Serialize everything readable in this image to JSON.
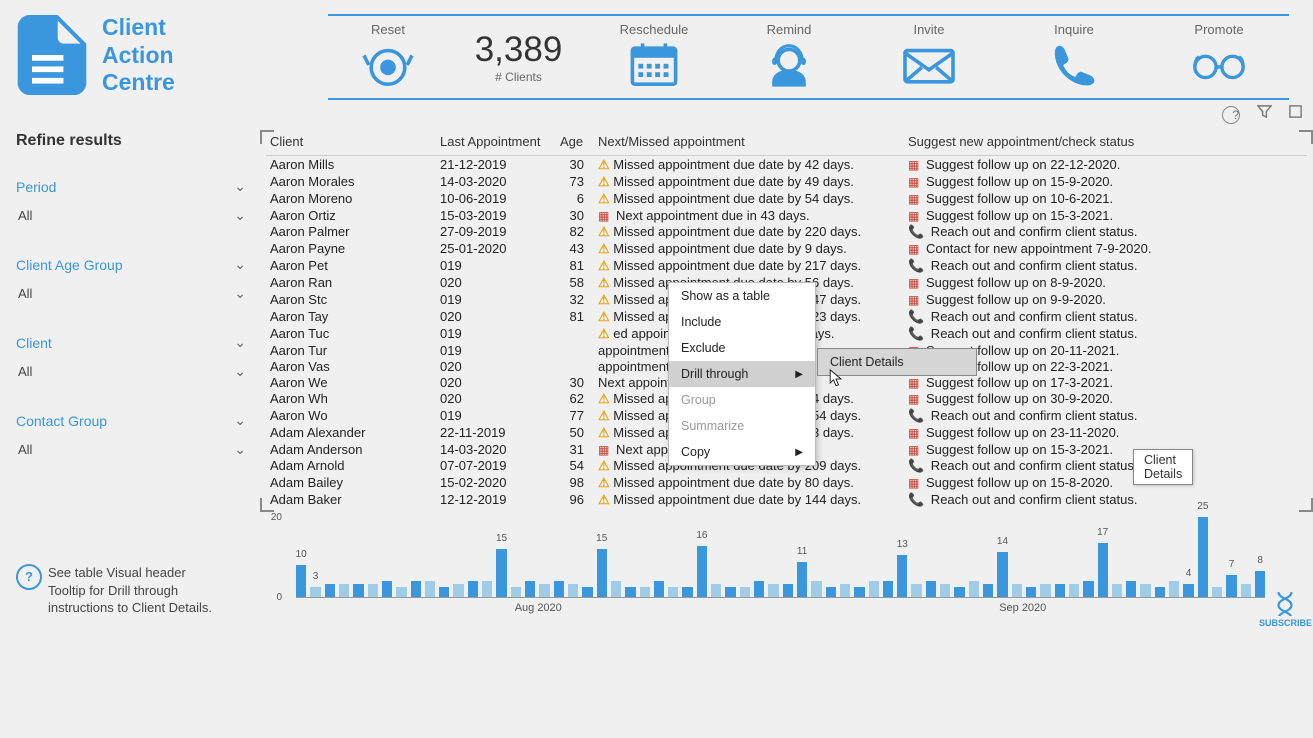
{
  "app": {
    "title_line1": "Client",
    "title_line2": "Action",
    "title_line3": "Centre"
  },
  "cards": {
    "reset": "Reset",
    "clients_value": "3,389",
    "clients_label": "# Clients",
    "reschedule": "Reschedule",
    "remind": "Remind",
    "invite": "Invite",
    "inquire": "Inquire",
    "promote": "Promote"
  },
  "filters": {
    "header": "Refine results",
    "period": {
      "label": "Period",
      "value": "All"
    },
    "age_group": {
      "label": "Client Age Group",
      "value": "All"
    },
    "client": {
      "label": "Client",
      "value": "All"
    },
    "contact_group": {
      "label": "Contact Group",
      "value": "All"
    }
  },
  "tip": "See table Visual header Tooltip for Drill through instructions to Client Details.",
  "table": {
    "headers": {
      "client": "Client",
      "last": "Last Appointment",
      "age": "Age",
      "next": "Next/Missed appointment",
      "suggest": "Suggest new appointment/check status"
    },
    "rows": [
      {
        "client": "Aaron Mills",
        "last": "21-12-2019",
        "age": "30",
        "next_icon": "warn",
        "next": "Missed appointment due date by 42 days.",
        "sugg_icon": "cal",
        "sugg": "Suggest follow up on 22-12-2020."
      },
      {
        "client": "Aaron Morales",
        "last": "14-03-2020",
        "age": "73",
        "next_icon": "warn",
        "next": "Missed appointment due date by 49 days.",
        "sugg_icon": "cal",
        "sugg": "Suggest follow up on 15-9-2020."
      },
      {
        "client": "Aaron Moreno",
        "last": "10-06-2019",
        "age": "6",
        "next_icon": "warn",
        "next": "Missed appointment due date by 54 days.",
        "sugg_icon": "cal",
        "sugg": "Suggest follow up on 10-6-2021."
      },
      {
        "client": "Aaron Ortiz",
        "last": "15-03-2019",
        "age": "30",
        "next_icon": "cal",
        "next": "Next appointment due in 43 days.",
        "sugg_icon": "cal",
        "sugg": "Suggest follow up on 15-3-2021."
      },
      {
        "client": "Aaron Palmer",
        "last": "27-09-2019",
        "age": "82",
        "next_icon": "warn",
        "next": "Missed appointment due date by 220 days.",
        "sugg_icon": "phone",
        "sugg": "Reach out and confirm client status."
      },
      {
        "client": "Aaron Payne",
        "last": "25-01-2020",
        "age": "43",
        "next_icon": "warn",
        "next": "Missed appointment due date by 9 days.",
        "sugg_icon": "cal",
        "sugg": "Contact for new appointment 7-9-2020."
      },
      {
        "client": "Aaron Pet",
        "last": "019",
        "age": "81",
        "next_icon": "warn",
        "next": "Missed appointment due date by 217 days.",
        "sugg_icon": "phone",
        "sugg": "Reach out and confirm client status."
      },
      {
        "client": "Aaron Ran",
        "last": "020",
        "age": "58",
        "next_icon": "warn",
        "next": "Missed appointment due date by 56 days.",
        "sugg_icon": "cal",
        "sugg": "Suggest follow up on 8-9-2020."
      },
      {
        "client": "Aaron Stc",
        "last": "019",
        "age": "32",
        "next_icon": "warn",
        "next": "Missed appointment due date by 147 days.",
        "sugg_icon": "cal",
        "sugg": "Suggest follow up on 9-9-2020."
      },
      {
        "client": "Aaron Tay",
        "last": "020",
        "age": "81",
        "next_icon": "warn",
        "next": "Missed appointment due date by 123 days.",
        "sugg_icon": "phone",
        "sugg": "Reach out and confirm client status."
      },
      {
        "client": "Aaron Tuc",
        "last": "019",
        "age": "",
        "next_icon": "warn",
        "next": "ed appointment due date by 318 days.",
        "sugg_icon": "phone",
        "sugg": "Reach out and confirm client status."
      },
      {
        "client": "Aaron Tur",
        "last": "019",
        "age": "",
        "next_icon": "",
        "next": "appointment due in 109 days.",
        "sugg_icon": "cal",
        "sugg": "Suggest follow up on 20-11-2021."
      },
      {
        "client": "Aaron Vas",
        "last": "020",
        "age": "",
        "next_icon": "",
        "next": "appointment due in 49 days.",
        "sugg_icon": "cal",
        "sugg": "Suggest follow up on 22-3-2021."
      },
      {
        "client": "Aaron We",
        "last": "020",
        "age": "30",
        "next_icon": "",
        "next": "Next appointment due in 45 days.",
        "sugg_icon": "cal",
        "sugg": "Suggest follow up on 17-3-2021."
      },
      {
        "client": "Aaron Wh",
        "last": "020",
        "age": "62",
        "next_icon": "warn",
        "next": "Missed appointment due date by 34 days.",
        "sugg_icon": "cal",
        "sugg": "Suggest follow up on 30-9-2020."
      },
      {
        "client": "Aaron Wo",
        "last": "019",
        "age": "77",
        "next_icon": "warn",
        "next": "Missed appointment due date by 154 days.",
        "sugg_icon": "phone",
        "sugg": "Reach out and confirm client status."
      },
      {
        "client": "Adam Alexander",
        "last": "22-11-2019",
        "age": "50",
        "next_icon": "warn",
        "next": "Missed appointment due date by 73 days.",
        "sugg_icon": "cal",
        "sugg": "Suggest follow up on 23-11-2020."
      },
      {
        "client": "Adam Anderson",
        "last": "14-03-2020",
        "age": "31",
        "next_icon": "cal",
        "next": "Next appointment due in 42 days.",
        "sugg_icon": "cal",
        "sugg": "Suggest follow up on 15-3-2021."
      },
      {
        "client": "Adam Arnold",
        "last": "07-07-2019",
        "age": "54",
        "next_icon": "warn",
        "next": "Missed appointment due date by 209 days.",
        "sugg_icon": "phone",
        "sugg": "Reach out and confirm client status."
      },
      {
        "client": "Adam Bailey",
        "last": "15-02-2020",
        "age": "98",
        "next_icon": "warn",
        "next": "Missed appointment due date by 80 days.",
        "sugg_icon": "cal",
        "sugg": "Suggest follow up on 15-8-2020."
      },
      {
        "client": "Adam Baker",
        "last": "12-12-2019",
        "age": "96",
        "next_icon": "warn",
        "next": "Missed appointment due date by 144 days.",
        "sugg_icon": "phone",
        "sugg": "Reach out and confirm client status."
      }
    ]
  },
  "context_menu": {
    "show_table": "Show as a table",
    "include": "Include",
    "exclude": "Exclude",
    "drill": "Drill through",
    "group": "Group",
    "summarize": "Summarize",
    "copy": "Copy",
    "sub_client_details": "Client Details",
    "tooltip": "Client Details"
  },
  "chart_data": {
    "type": "bar",
    "months": [
      "Aug 2020",
      "Sep 2020"
    ],
    "ylim": [
      0,
      25
    ],
    "y_ticks": [
      "0",
      "20"
    ],
    "bars": [
      {
        "v": 10,
        "alt": false,
        "lbl": "10"
      },
      {
        "v": 3,
        "alt": true,
        "lbl": "3"
      },
      {
        "v": 4,
        "alt": false
      },
      {
        "v": 4,
        "alt": true
      },
      {
        "v": 4,
        "alt": false
      },
      {
        "v": 4,
        "alt": true
      },
      {
        "v": 5,
        "alt": false
      },
      {
        "v": 3,
        "alt": true
      },
      {
        "v": 5,
        "alt": false
      },
      {
        "v": 5,
        "alt": true
      },
      {
        "v": 3,
        "alt": false
      },
      {
        "v": 4,
        "alt": true
      },
      {
        "v": 5,
        "alt": false
      },
      {
        "v": 5,
        "alt": true
      },
      {
        "v": 15,
        "alt": false,
        "lbl": "15"
      },
      {
        "v": 3,
        "alt": true
      },
      {
        "v": 5,
        "alt": false
      },
      {
        "v": 4,
        "alt": true
      },
      {
        "v": 5,
        "alt": false
      },
      {
        "v": 4,
        "alt": true
      },
      {
        "v": 3,
        "alt": false
      },
      {
        "v": 15,
        "alt": false,
        "lbl": "15"
      },
      {
        "v": 5,
        "alt": true
      },
      {
        "v": 3,
        "alt": false
      },
      {
        "v": 3,
        "alt": true
      },
      {
        "v": 5,
        "alt": false
      },
      {
        "v": 3,
        "alt": true
      },
      {
        "v": 3,
        "alt": false
      },
      {
        "v": 16,
        "alt": false,
        "lbl": "16"
      },
      {
        "v": 4,
        "alt": true
      },
      {
        "v": 3,
        "alt": false
      },
      {
        "v": 3,
        "alt": true
      },
      {
        "v": 5,
        "alt": false
      },
      {
        "v": 4,
        "alt": true
      },
      {
        "v": 4,
        "alt": false
      },
      {
        "v": 11,
        "alt": false,
        "lbl": "11"
      },
      {
        "v": 5,
        "alt": true
      },
      {
        "v": 3,
        "alt": false
      },
      {
        "v": 4,
        "alt": true
      },
      {
        "v": 3,
        "alt": false
      },
      {
        "v": 5,
        "alt": true
      },
      {
        "v": 5,
        "alt": false
      },
      {
        "v": 13,
        "alt": false,
        "lbl": "13"
      },
      {
        "v": 4,
        "alt": true
      },
      {
        "v": 5,
        "alt": false
      },
      {
        "v": 4,
        "alt": true
      },
      {
        "v": 3,
        "alt": false
      },
      {
        "v": 5,
        "alt": true
      },
      {
        "v": 4,
        "alt": false
      },
      {
        "v": 14,
        "alt": false,
        "lbl": "14"
      },
      {
        "v": 4,
        "alt": true
      },
      {
        "v": 3,
        "alt": false
      },
      {
        "v": 4,
        "alt": true
      },
      {
        "v": 4,
        "alt": false
      },
      {
        "v": 4,
        "alt": true
      },
      {
        "v": 5,
        "alt": false
      },
      {
        "v": 17,
        "alt": false,
        "lbl": "17"
      },
      {
        "v": 4,
        "alt": true
      },
      {
        "v": 5,
        "alt": false
      },
      {
        "v": 4,
        "alt": true
      },
      {
        "v": 3,
        "alt": false
      },
      {
        "v": 5,
        "alt": true
      },
      {
        "v": 4,
        "alt": false,
        "lbl": "4"
      },
      {
        "v": 25,
        "alt": false,
        "lbl": "25"
      },
      {
        "v": 3,
        "alt": true
      },
      {
        "v": 7,
        "alt": false,
        "lbl": "7"
      },
      {
        "v": 4,
        "alt": true
      },
      {
        "v": 8,
        "alt": false,
        "lbl": "8"
      }
    ]
  },
  "subscribe": "SUBSCRIBE"
}
